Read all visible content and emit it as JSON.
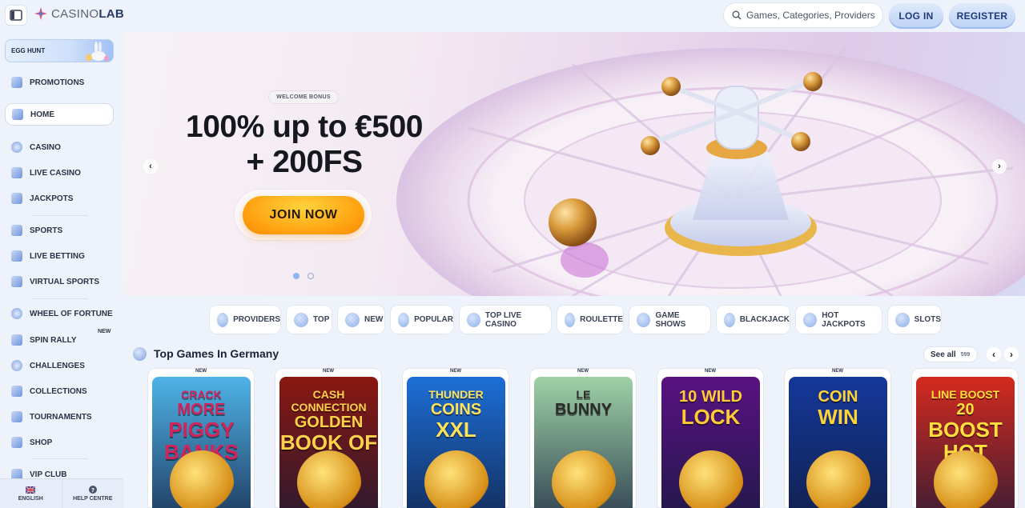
{
  "header": {
    "logo_light": "CASINO",
    "logo_bold": "LAB",
    "search_placeholder": "Games, Categories, Providers",
    "login": "LOG IN",
    "register": "REGISTER"
  },
  "sidebar": {
    "promo_banner": "EGG HUNT",
    "items": [
      {
        "label": "PROMOTIONS",
        "icon": "megaphone-icon"
      },
      {
        "label": "HOME",
        "icon": "home-icon"
      },
      {
        "label": "CASINO",
        "icon": "casino-chip-icon"
      },
      {
        "label": "LIVE CASINO",
        "icon": "live-casino-icon"
      },
      {
        "label": "JACKPOTS",
        "icon": "jackpot-icon"
      },
      {
        "label": "SPORTS",
        "icon": "sports-icon"
      },
      {
        "label": "LIVE BETTING",
        "icon": "live-betting-icon"
      },
      {
        "label": "VIRTUAL SPORTS",
        "icon": "virtual-sports-icon"
      },
      {
        "label": "WHEEL OF FORTUNE",
        "icon": "wheel-icon"
      },
      {
        "label": "SPIN RALLY",
        "icon": "spin-rally-icon"
      },
      {
        "label": "CHALLENGES",
        "icon": "challenges-icon"
      },
      {
        "label": "COLLECTIONS",
        "icon": "collections-icon"
      },
      {
        "label": "TOURNAMENTS",
        "icon": "trophy-icon"
      },
      {
        "label": "SHOP",
        "icon": "shop-icon"
      },
      {
        "label": "VIP CLUB",
        "icon": "vip-icon"
      }
    ],
    "new_tag": "NEW",
    "language": "ENGLISH",
    "help": "HELP CENTRE"
  },
  "hero": {
    "badge": "WELCOME BONUS",
    "title_line1": "100% up to €500",
    "title_line2": "+ 200FS",
    "cta": "JOIN NOW",
    "prev": "‹",
    "next": "›"
  },
  "categories": [
    {
      "label": "PROVIDERS",
      "icon": "providers-icon"
    },
    {
      "label": "TOP",
      "icon": "top-icon"
    },
    {
      "label": "NEW",
      "icon": "new-icon"
    },
    {
      "label": "POPULAR",
      "icon": "star-icon"
    },
    {
      "label": "TOP LIVE CASINO",
      "icon": "live-icon"
    },
    {
      "label": "ROULETTE",
      "icon": "roulette-icon"
    },
    {
      "label": "GAME SHOWS",
      "icon": "game-shows-icon"
    },
    {
      "label": "BLACKJACK",
      "icon": "cards-icon"
    },
    {
      "label": "HOT JACKPOTS",
      "icon": "hot-jackpots-icon"
    },
    {
      "label": "SLOTS",
      "icon": "slots-icon"
    }
  ],
  "section": {
    "title": "Top Games In Germany",
    "see_all": "See all",
    "count": "599",
    "prev": "‹",
    "next": "›"
  },
  "games": [
    {
      "tag": "NEW",
      "l1": "CRACK",
      "l2": "MORE",
      "l3": "PIGGY BANKS",
      "bg": "#4fb3e8",
      "fg": "#d2245a"
    },
    {
      "tag": "NEW",
      "l1": "CASH CONNECTION",
      "l2": "GOLDEN",
      "l3": "BOOK OF RA",
      "bg": "#8a1810",
      "fg": "#ffd24a"
    },
    {
      "tag": "NEW",
      "l1": "THUNDER",
      "l2": "COINS",
      "l3": "XXL",
      "bg": "#1c6fd6",
      "fg": "#ffe15a"
    },
    {
      "tag": "NEW",
      "l1": "LE",
      "l2": "BUNNY",
      "l3": "",
      "bg": "#9fd1a6",
      "fg": "#2b2b2b"
    },
    {
      "tag": "NEW",
      "l1": "",
      "l2": "10 WILD",
      "l3": "LOCK",
      "bg": "#5a1282",
      "fg": "#ffcc33"
    },
    {
      "tag": "NEW",
      "l1": "",
      "l2": "COIN",
      "l3": "WIN",
      "bg": "#14389a",
      "fg": "#ffd23a"
    },
    {
      "tag": "",
      "l1": "LINE BOOST",
      "l2": "20",
      "l3": "BOOST HOT",
      "bg": "#d42a1f",
      "fg": "#ffdf3d"
    }
  ]
}
